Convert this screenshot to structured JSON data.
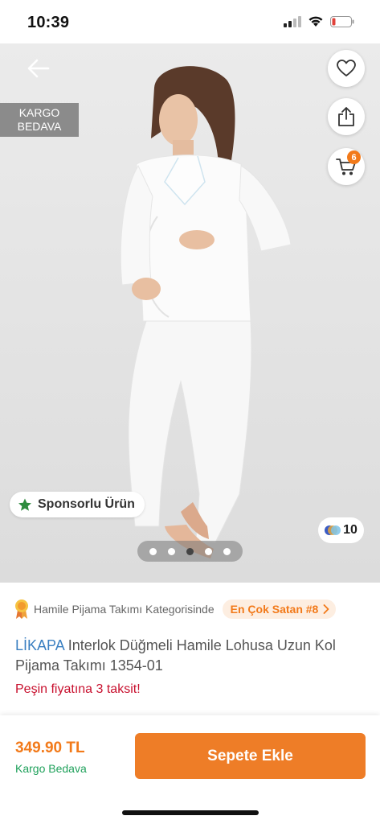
{
  "status_bar": {
    "time": "10:39"
  },
  "hero": {
    "cargo_badge": [
      "KARGO",
      "BEDAVA"
    ],
    "cart_count": "6",
    "sponsor_label": "Sponsorlu Ürün",
    "image_count": "10",
    "pagination": {
      "total": 5,
      "active": 3
    }
  },
  "info": {
    "category_text": "Hamile Pijama Takımı Kategorisinde",
    "best_seller": "En Çok Satan #8",
    "brand": "LİKAPA",
    "title": "Interlok Düğmeli Hamile Lohusa Uzun Kol Pijama Takımı 1354-01",
    "installment": "Peşin fiyatına 3 taksit!"
  },
  "bottom": {
    "price": "349.90 TL",
    "cargo": "Kargo Bedava",
    "add_button": "Sepete Ekle"
  },
  "colors": {
    "accent": "#f27a1a",
    "button": "#ee7d27",
    "brand": "#3a7fc1",
    "green": "#1fa15b",
    "red": "#c8102e"
  },
  "icons": [
    "signal-icon",
    "wifi-icon",
    "battery-icon",
    "back-arrow-icon",
    "heart-icon",
    "share-icon",
    "cart-icon",
    "star-icon",
    "gallery-icon",
    "medal-icon",
    "chevron-right-icon"
  ]
}
